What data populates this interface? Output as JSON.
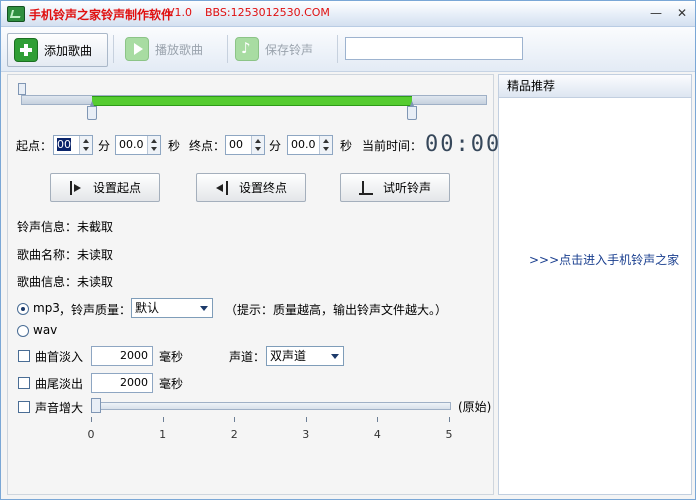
{
  "window": {
    "title": "手机铃声之家铃声制作软件",
    "version": "V1.0",
    "bbs": "BBS:1253012530.COM",
    "minimize": "—",
    "close": "✕"
  },
  "toolbar": {
    "add_song": "添加歌曲",
    "play_song": "播放歌曲",
    "save_ringtone": "保存铃声",
    "search_value": ""
  },
  "range": {
    "start_fraction": 0.15,
    "end_fraction": 0.84
  },
  "time": {
    "start_label": "起点：",
    "start_min": "00",
    "min_unit": "分",
    "start_sec": "00.0",
    "sec_unit": "秒",
    "end_label": "终点：",
    "end_min": "00",
    "end_sec": "00.0",
    "current_label": "当前时间：",
    "current_value": "00:00"
  },
  "buttons": {
    "set_start": "设置起点",
    "set_end": "设置终点",
    "preview": "试听铃声"
  },
  "info": {
    "ringtone_info": "铃声信息：未截取",
    "song_name": "歌曲名称：未读取",
    "song_info": "歌曲信息：未读取"
  },
  "format": {
    "mp3": "mp3",
    "quality_label": "，铃声质量：",
    "quality_value": "默认",
    "hint": "（提示：质量越高，输出铃声文件越大。）",
    "wav": "wav"
  },
  "effects": {
    "fade_in": "曲首淡入",
    "fade_in_value": "2000",
    "fade_out": "曲尾淡出",
    "fade_out_value": "2000",
    "ms": "毫秒",
    "channel_label": "声道：",
    "channel_value": "双声道",
    "volume": "声音增大",
    "volume_level": 0,
    "volume_note": "(原始)",
    "ticks": [
      "0",
      "1",
      "2",
      "3",
      "4",
      "5"
    ]
  },
  "sidebar": {
    "header": "精品推荐",
    "link": ">>>点击进入手机铃声之家"
  }
}
